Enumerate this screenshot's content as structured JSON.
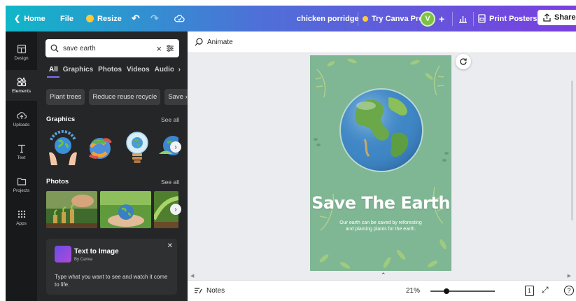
{
  "topbar": {
    "home": "Home",
    "file": "File",
    "resize": "Resize",
    "doc_title": "chicken porridge",
    "try_pro": "Try Canva Pro",
    "avatar_initial": "V",
    "print": "Print Posters",
    "share": "Share"
  },
  "rail": {
    "items": [
      {
        "label": "Design",
        "icon": "layout-icon"
      },
      {
        "label": "Elements",
        "icon": "shapes-icon"
      },
      {
        "label": "Uploads",
        "icon": "cloud-upload-icon"
      },
      {
        "label": "Text",
        "icon": "text-icon"
      },
      {
        "label": "Projects",
        "icon": "folder-icon"
      },
      {
        "label": "Apps",
        "icon": "apps-grid-icon"
      }
    ]
  },
  "panel": {
    "search_value": "save earth",
    "tabs": [
      "All",
      "Graphics",
      "Photos",
      "Videos",
      "Audio"
    ],
    "chips": [
      "Plant trees",
      "Reduce reuse recycle",
      "Save"
    ],
    "graphics_title": "Graphics",
    "photos_title": "Photos",
    "see_all": "See all",
    "t2i": {
      "title": "Text to Image",
      "by": "By Canva",
      "desc": "Type what you want to see and watch it come to life."
    }
  },
  "canvas": {
    "animate": "Animate",
    "poster_title": "Save The Earth",
    "poster_subtitle": "Our earth can be saved by reforesting and planting plants for the earth."
  },
  "bottombar": {
    "notes": "Notes",
    "zoom": "21%",
    "page_number": "1",
    "zoom_fraction": 0.25
  },
  "colors": {
    "poster_green": "#7ab48c",
    "accent": "#7d6ef0"
  }
}
